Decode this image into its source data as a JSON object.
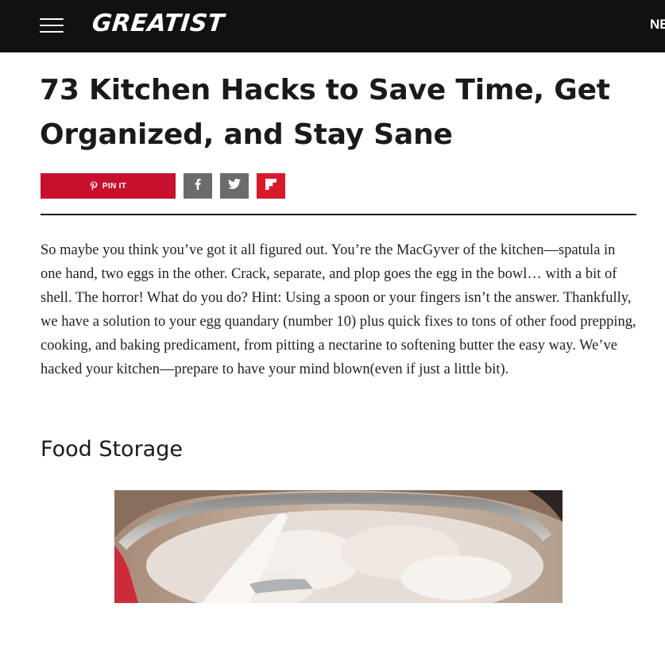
{
  "header": {
    "logo_text": "GREATIST",
    "nav_partial": "NE",
    "menu_icon": "hamburger-menu-icon",
    "background": "#111111"
  },
  "article": {
    "title": "73 Kitchen Hacks to Save Time, Get Organized, and Stay Sane",
    "share": {
      "pin_label": "PIN IT",
      "pin_icon": "pinterest-icon",
      "facebook_icon": "facebook-icon",
      "twitter_icon": "twitter-icon",
      "flipboard_icon": "flipboard-icon",
      "pin_color": "#c8102e",
      "flipboard_color": "#d7192a",
      "social_color": "#6b6b6b"
    },
    "intro": "So maybe you think you’ve got it all figured out. You’re the MacGyver of the kitchen—spatula in one hand, two eggs in the other. Crack, separate, and plop goes the egg in the bowl… with a bit of shell. The horror! What do you do? Hint: Using a spoon or your fingers isn’t the answer. Thankfully, we have a solution to your egg quandary (number 10) plus quick fixes to tons of other food prepping, cooking, and baking predicament, from pitting a nectarine to softening butter the easy way. We’ve hacked your kitchen—prepare to have your mind blown(even if just a little bit).",
    "section_heading": "Food Storage"
  }
}
